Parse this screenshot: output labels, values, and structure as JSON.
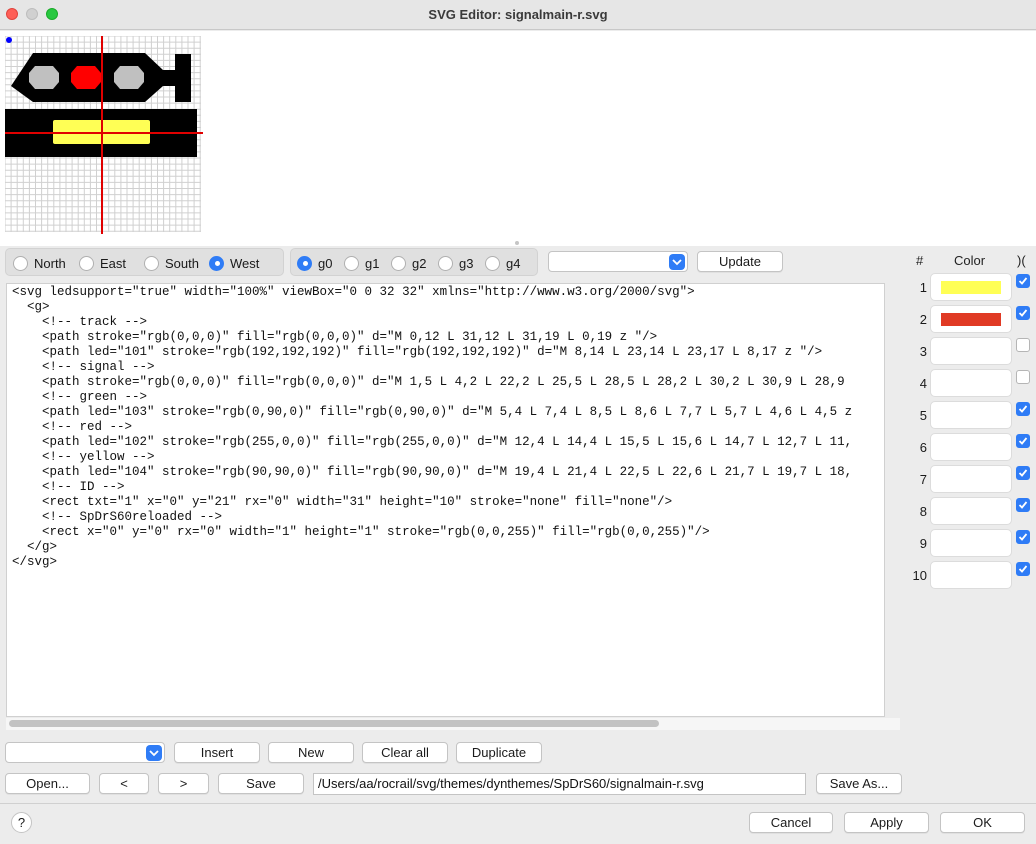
{
  "window": {
    "title": "SVG Editor: signalmain-r.svg"
  },
  "orientation": {
    "options": [
      "North",
      "East",
      "South",
      "West"
    ],
    "selected": "West"
  },
  "groups": {
    "options": [
      "g0",
      "g1",
      "g2",
      "g3",
      "g4"
    ],
    "selected": "g0"
  },
  "top_select": {
    "value": ""
  },
  "update_label": "Update",
  "code_lines": [
    "<svg ledsupport=\"true\" width=\"100%\" viewBox=\"0 0 32 32\" xmlns=\"http://www.w3.org/2000/svg\">",
    "  <g>",
    "    <!-- track -->",
    "    <path stroke=\"rgb(0,0,0)\" fill=\"rgb(0,0,0)\" d=\"M 0,12 L 31,12 L 31,19 L 0,19 z \"/>",
    "    <path led=\"101\" stroke=\"rgb(192,192,192)\" fill=\"rgb(192,192,192)\" d=\"M 8,14 L 23,14 L 23,17 L 8,17 z \"/>",
    "    <!-- signal -->",
    "    <path stroke=\"rgb(0,0,0)\" fill=\"rgb(0,0,0)\" d=\"M 1,5 L 4,2 L 22,2 L 25,5 L 28,5 L 28,2 L 30,2 L 30,9 L 28,9",
    "    <!-- green -->",
    "    <path led=\"103\" stroke=\"rgb(0,90,0)\" fill=\"rgb(0,90,0)\" d=\"M 5,4 L 7,4 L 8,5 L 8,6 L 7,7 L 5,7 L 4,6 L 4,5 z",
    "    <!-- red -->",
    "    <path led=\"102\" stroke=\"rgb(255,0,0)\" fill=\"rgb(255,0,0)\" d=\"M 12,4 L 14,4 L 15,5 L 15,6 L 14,7 L 12,7 L 11,",
    "    <!-- yellow -->",
    "    <path led=\"104\" stroke=\"rgb(90,90,0)\" fill=\"rgb(90,90,0)\" d=\"M 19,4 L 21,4 L 22,5 L 22,6 L 21,7 L 19,7 L 18,",
    "    <!-- ID -->",
    "    <rect txt=\"1\" x=\"0\" y=\"21\" rx=\"0\" width=\"31\" height=\"10\" stroke=\"none\" fill=\"none\"/>",
    "    <!-- SpDrS60reloaded -->",
    "    <rect x=\"0\" y=\"0\" rx=\"0\" width=\"1\" height=\"1\" stroke=\"rgb(0,0,255)\" fill=\"rgb(0,0,255)\"/>",
    "  </g>",
    "</svg>"
  ],
  "color_table": {
    "headers": {
      "num": "#",
      "color": "Color",
      "check": ")("
    },
    "rows": [
      {
        "num": "1",
        "color": "#ffff55",
        "checked": true
      },
      {
        "num": "2",
        "color": "#e03a24",
        "checked": true
      },
      {
        "num": "3",
        "color": "",
        "checked": false
      },
      {
        "num": "4",
        "color": "",
        "checked": false
      },
      {
        "num": "5",
        "color": "",
        "checked": true
      },
      {
        "num": "6",
        "color": "",
        "checked": true
      },
      {
        "num": "7",
        "color": "",
        "checked": true
      },
      {
        "num": "8",
        "color": "",
        "checked": true
      },
      {
        "num": "9",
        "color": "",
        "checked": true
      },
      {
        "num": "10",
        "color": "",
        "checked": true
      }
    ]
  },
  "edit_toolbar": {
    "select_value": "",
    "insert": "Insert",
    "new": "New",
    "clear_all": "Clear all",
    "duplicate": "Duplicate"
  },
  "file_toolbar": {
    "open": "Open...",
    "prev": "<",
    "next": ">",
    "save": "Save",
    "path": "/Users/aa/rocrail/svg/themes/dynthemes/SpDrS60/signalmain-r.svg",
    "save_as": "Save As..."
  },
  "dialog_buttons": {
    "help": "?",
    "cancel": "Cancel",
    "apply": "Apply",
    "ok": "OK"
  },
  "preview_colors": {
    "body": "#000000",
    "lamp_off": "#c0c0c0",
    "lamp_red": "#ff0000",
    "led_bar": "#ffff55",
    "axis": "#e00000",
    "marker": "#0000ff"
  }
}
